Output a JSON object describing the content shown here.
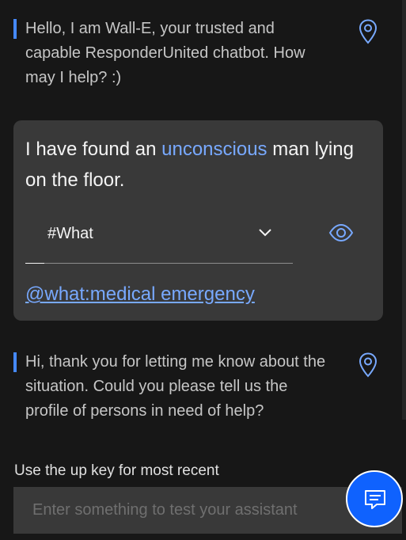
{
  "messages": {
    "bot_greeting": "Hello, I am Wall-E, your trusted and capable ResponderUnited chatbot. How may I help? :)",
    "user_before": "I have found an ",
    "user_highlight": "unconscious",
    "user_after": " man lying on the floor.",
    "intent_value": "#What",
    "entity_link": "@what:medical emergency",
    "bot_reply": "Hi, thank you for letting me know about the situation. Could you please tell us the profile of persons in need of help?"
  },
  "footer": {
    "hint": "Use the up key for most recent",
    "input_placeholder": "Enter something to test your assistant"
  },
  "icons": {
    "location": "location-pin-icon",
    "view": "eye-icon",
    "chevron": "chevron-down-icon",
    "chat": "chat-icon"
  },
  "colors": {
    "background": "#171717",
    "card": "#393939",
    "accent": "#4589ff",
    "link": "#78a9ff",
    "launcher": "#0f62fe"
  }
}
